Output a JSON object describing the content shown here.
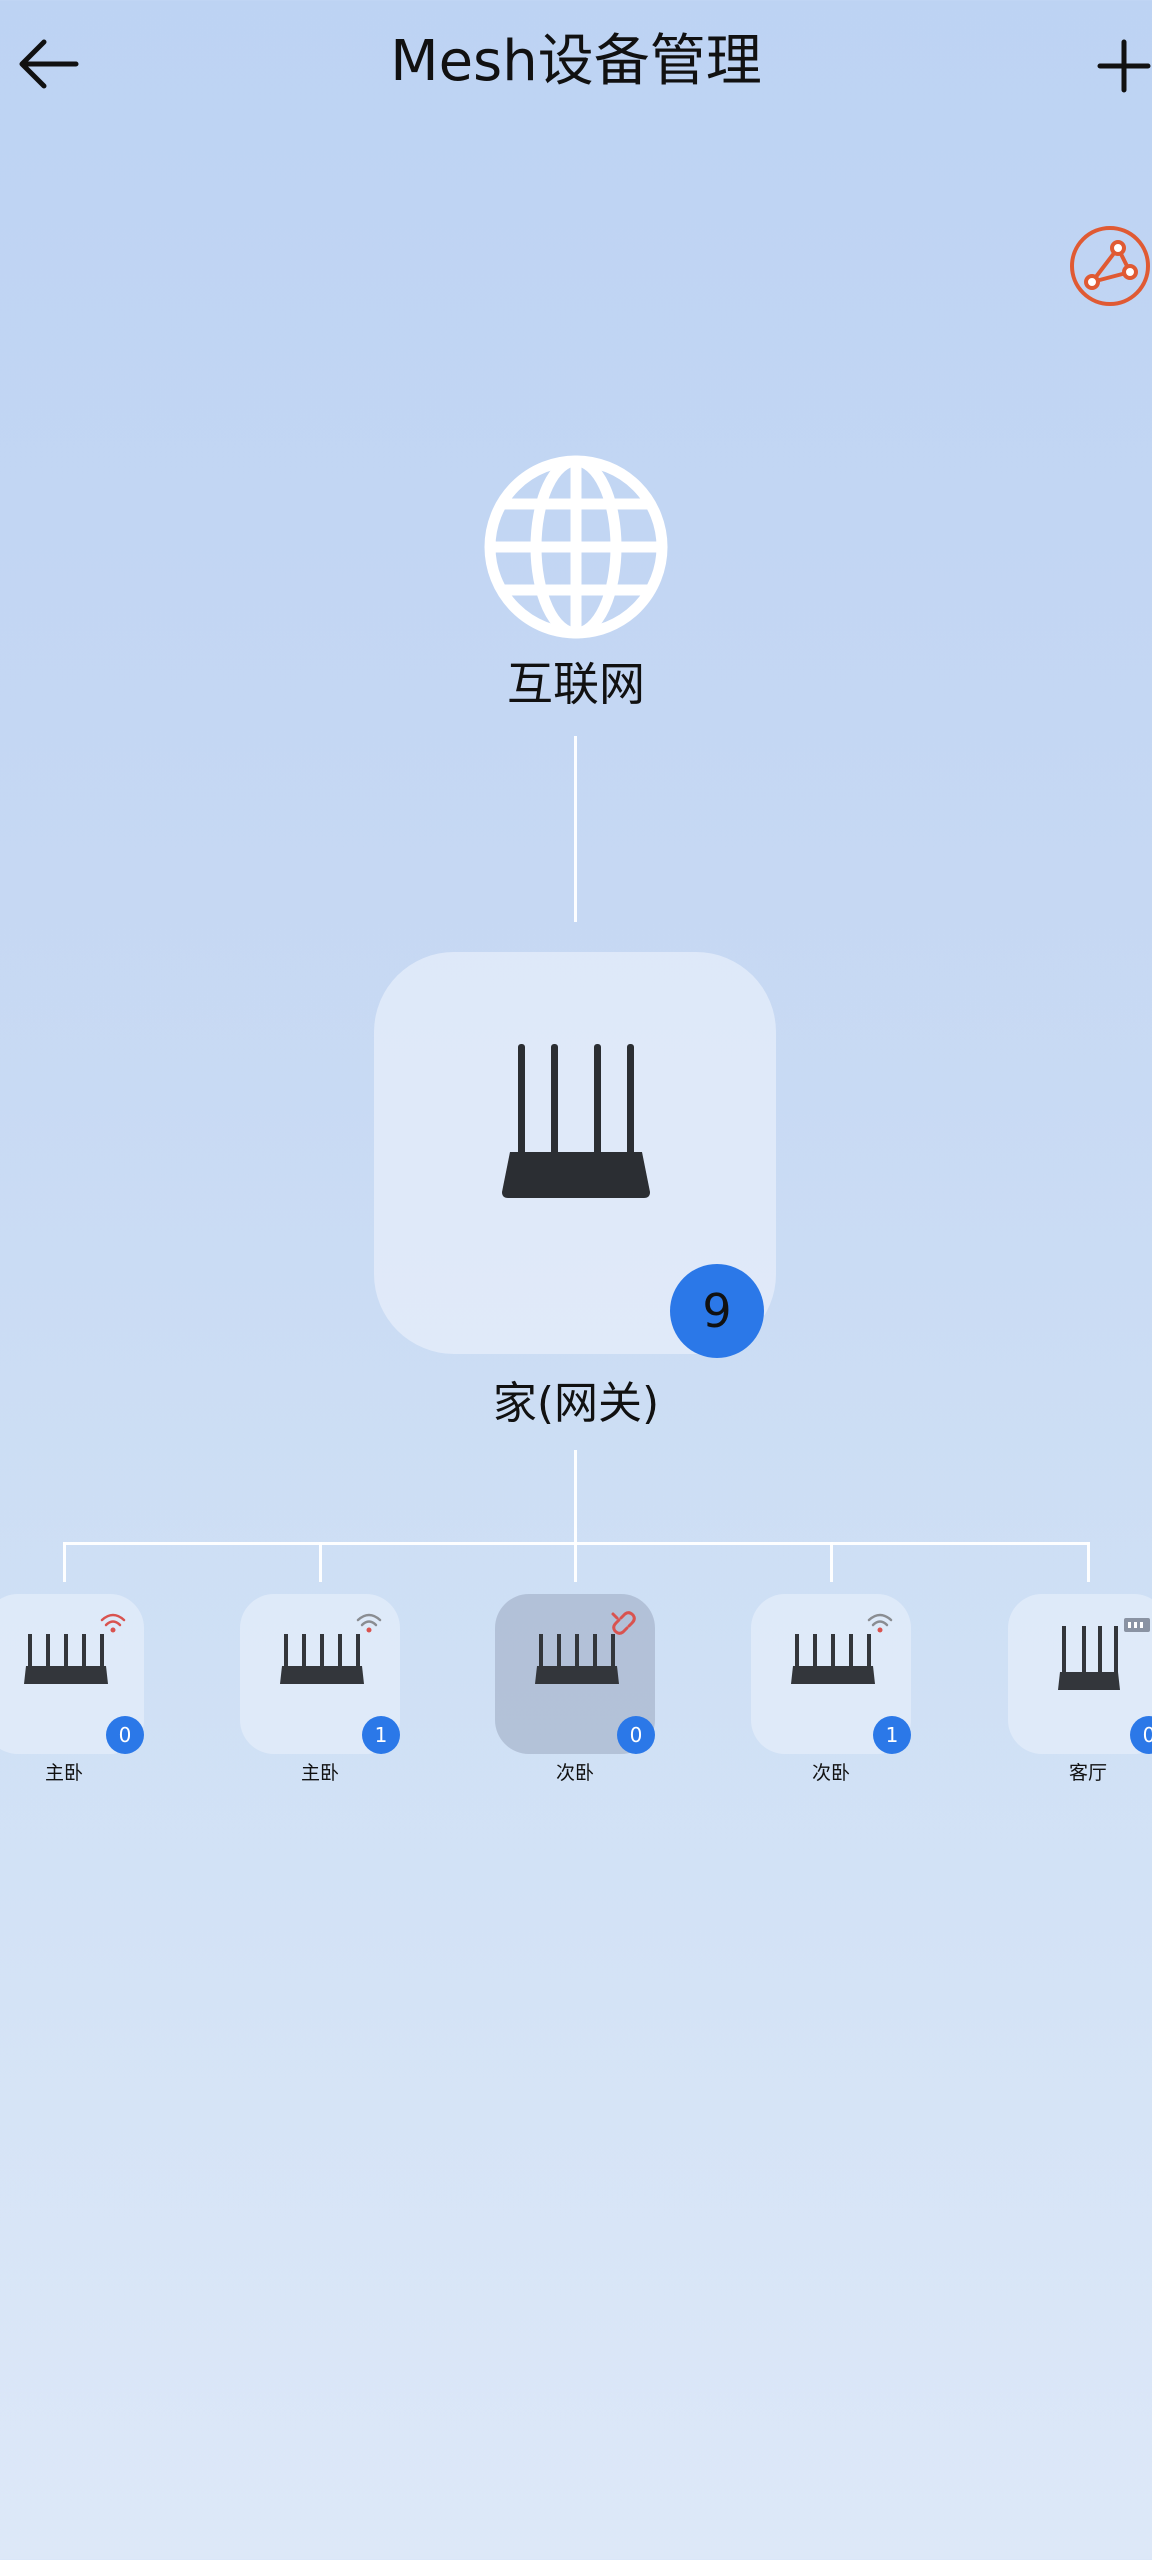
{
  "header": {
    "title": "Mesh设备管理",
    "back_icon": "arrow-left-icon",
    "add_icon": "plus-icon"
  },
  "topology_button": {
    "icon": "topology-icon",
    "color": "#e05a33"
  },
  "internet": {
    "label": "互联网",
    "icon": "globe-icon"
  },
  "gateway": {
    "label": "家(网关)",
    "badge": "9",
    "icon": "router-icon"
  },
  "nodes": [
    {
      "label": "主卧",
      "badge": "0",
      "status_icon": "wifi-signal-icon",
      "selected": false
    },
    {
      "label": "主卧",
      "badge": "1",
      "status_icon": "wifi-signal-icon",
      "selected": false
    },
    {
      "label": "次卧",
      "badge": "0",
      "status_icon": "link-broken-icon",
      "selected": true
    },
    {
      "label": "次卧",
      "badge": "1",
      "status_icon": "wifi-signal-icon",
      "selected": false
    },
    {
      "label": "客厅",
      "badge": "0",
      "status_icon": "ethernet-icon",
      "selected": false
    }
  ],
  "colors": {
    "accent": "#2b78e8",
    "wifi": "#d9534f",
    "topology": "#e05a33"
  }
}
